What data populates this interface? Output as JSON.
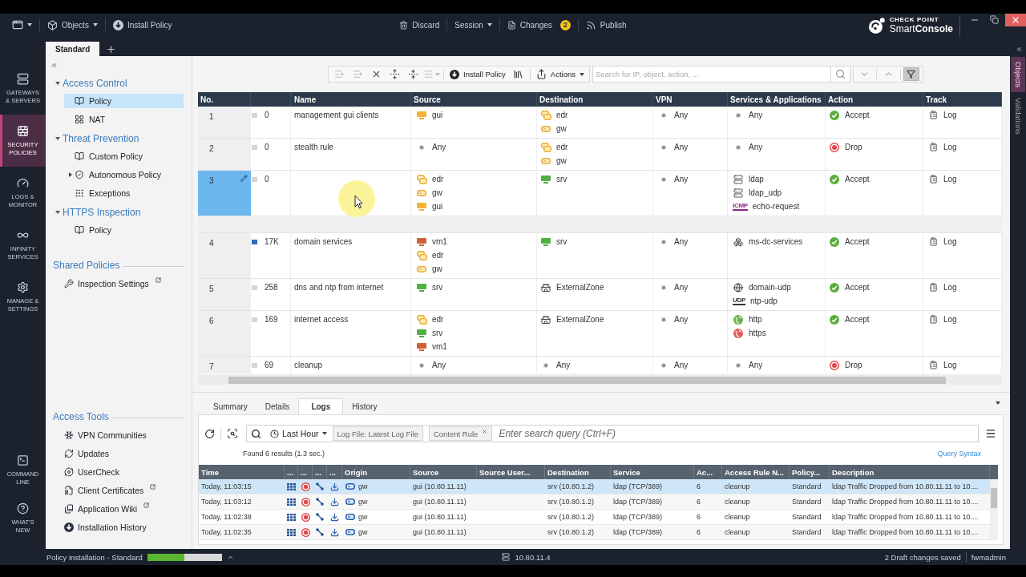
{
  "top_bar": {
    "objects": "Objects",
    "install_policy": "Install Policy",
    "discard": "Discard",
    "session": "Session",
    "changes": "Changes",
    "changes_count": "2",
    "publish": "Publish"
  },
  "brand": {
    "company": "CHECK POINT",
    "product": "Smart**Console**"
  },
  "policy_tabs": [
    {
      "label": "Standard",
      "selected": true
    }
  ],
  "side_tabs": [
    {
      "label": "Objects",
      "selected": true
    },
    {
      "label": "Validations",
      "selected": false
    }
  ],
  "nav": {
    "top": [
      {
        "kind": "gateways",
        "label": "GATEWAYS\n& SERVERS",
        "selected": false
      },
      {
        "kind": "policies",
        "label": "SECURITY\nPOLICIES",
        "selected": true
      },
      {
        "kind": "logs",
        "label": "LOGS &\nMONITOR",
        "selected": false
      },
      {
        "kind": "infinity",
        "label": "INFINITY\nSERVICES",
        "selected": false
      },
      {
        "kind": "manage",
        "label": "MANAGE &\nSETTINGS",
        "selected": false
      }
    ],
    "bottom": [
      {
        "kind": "command",
        "label": "COMMAND\nLINE",
        "selected": false
      },
      {
        "kind": "whatsnew",
        "label": "WHAT'S\nNEW",
        "selected": false
      }
    ]
  },
  "tree": [
    {
      "label": "Access Control",
      "expanded": true,
      "children": [
        {
          "label": "Policy",
          "kind": "policy",
          "selected": true
        },
        {
          "label": "NAT",
          "kind": "nat",
          "selected": false
        }
      ]
    },
    {
      "label": "Threat Prevention",
      "expanded": true,
      "children": [
        {
          "label": "Custom Policy",
          "kind": "policy",
          "selected": false
        },
        {
          "label": "Autonomous Policy",
          "kind": "autonomous",
          "selected": false,
          "expanded": false
        },
        {
          "label": "Exceptions",
          "kind": "exceptions",
          "selected": false
        }
      ]
    },
    {
      "label": "HTTPS Inspection",
      "expanded": true,
      "children": [
        {
          "label": "Policy",
          "kind": "policy",
          "selected": false
        }
      ]
    }
  ],
  "shared_policies": {
    "title": "Shared Policies",
    "items": [
      {
        "label": "Inspection Settings",
        "kind": "wrench",
        "external": true
      }
    ]
  },
  "access_tools": {
    "title": "Access Tools",
    "items": [
      {
        "label": "VPN Communities",
        "kind": "vpn",
        "external": false
      },
      {
        "label": "Updates",
        "kind": "updates",
        "external": false
      },
      {
        "label": "UserCheck",
        "kind": "usercheck",
        "external": false
      },
      {
        "label": "Client Certificates",
        "kind": "certificates",
        "external": true
      },
      {
        "label": "Application Wiki",
        "kind": "wiki",
        "external": true
      },
      {
        "label": "Installation History",
        "kind": "history",
        "external": false
      }
    ]
  },
  "rule_toolbar": {
    "tools": [
      {
        "kind": "add_above",
        "disabled": true
      },
      {
        "kind": "add_below",
        "disabled": true
      },
      {
        "kind": "delete",
        "disabled": false
      },
      {
        "kind": "expand",
        "disabled": false
      },
      {
        "kind": "collapse",
        "disabled": false
      },
      {
        "kind": "menu",
        "disabled": true
      }
    ],
    "install_policy": "Install Policy",
    "actions": "Actions",
    "search": {
      "placeholder": "Search for IP, object, action, ..."
    },
    "filter_on": true
  },
  "rule_table": {
    "columns": [
      "No.",
      "Name",
      "Source",
      "Destination",
      "VPN",
      "Services & Applications",
      "Action",
      "Track"
    ],
    "rows": [
      {
        "kind": "rule",
        "no": "1",
        "hits": "0",
        "high_hits": false,
        "selected": false,
        "edited": false,
        "name": "management gui clients",
        "source": [
          {
            "kind": "host",
            "name": "gui",
            "color": "#f2b437"
          }
        ],
        "destination": [
          {
            "kind": "cluster",
            "name": "edr"
          },
          {
            "kind": "gateway",
            "name": "gw"
          }
        ],
        "vpn": [
          {
            "kind": "any",
            "name": "Any"
          }
        ],
        "services": [
          {
            "kind": "any",
            "name": "Any"
          }
        ],
        "action": {
          "kind": "accept",
          "label": "Accept"
        },
        "track": "Log"
      },
      {
        "kind": "rule",
        "no": "2",
        "hits": "0",
        "high_hits": false,
        "selected": false,
        "edited": false,
        "name": "stealth rule",
        "source": [
          {
            "kind": "any",
            "name": "Any"
          }
        ],
        "destination": [
          {
            "kind": "cluster",
            "name": "edr"
          },
          {
            "kind": "gateway",
            "name": "gw"
          }
        ],
        "vpn": [
          {
            "kind": "any",
            "name": "Any"
          }
        ],
        "services": [
          {
            "kind": "any",
            "name": "Any"
          }
        ],
        "action": {
          "kind": "drop",
          "label": "Drop"
        },
        "track": "Log"
      },
      {
        "kind": "rule",
        "no": "3",
        "hits": "0",
        "high_hits": false,
        "selected": true,
        "edited": true,
        "source": [
          {
            "kind": "cluster",
            "name": "edr"
          },
          {
            "kind": "gateway",
            "name": "gw"
          },
          {
            "kind": "host",
            "name": "gui",
            "color": "#f2b437"
          }
        ],
        "destination": [
          {
            "kind": "host",
            "name": "srv",
            "color": "#52b043"
          }
        ],
        "vpn": [
          {
            "kind": "any",
            "name": "Any"
          }
        ],
        "services": [
          {
            "kind": "ldap",
            "name": "ldap"
          },
          {
            "kind": "ldap",
            "name": "ldap_udp"
          },
          {
            "kind": "icmp",
            "tag": "ICMP",
            "name": "echo-request"
          }
        ],
        "action": {
          "kind": "accept",
          "label": "Accept"
        },
        "track": "Log"
      },
      {
        "kind": "section"
      },
      {
        "kind": "rule",
        "no": "4",
        "hits": "17K",
        "high_hits": true,
        "selected": false,
        "edited": false,
        "name": "domain services",
        "source": [
          {
            "kind": "host",
            "name": "vm1",
            "color": "#d2603a"
          },
          {
            "kind": "cluster",
            "name": "edr"
          },
          {
            "kind": "gateway",
            "name": "gw"
          }
        ],
        "destination": [
          {
            "kind": "host",
            "name": "srv",
            "color": "#52b043"
          }
        ],
        "vpn": [
          {
            "kind": "any",
            "name": "Any"
          }
        ],
        "services": [
          {
            "kind": "group",
            "name": "ms-dc-services"
          }
        ],
        "action": {
          "kind": "accept",
          "label": "Accept"
        },
        "track": "Log"
      },
      {
        "kind": "rule",
        "no": "5",
        "hits": "258",
        "high_hits": false,
        "selected": false,
        "edited": false,
        "name": "dns and ntp from internet",
        "source": [
          {
            "kind": "host",
            "name": "srv",
            "color": "#52b043"
          }
        ],
        "destination": [
          {
            "kind": "zone",
            "name": "ExternalZone"
          }
        ],
        "vpn": [
          {
            "kind": "any",
            "name": "Any"
          }
        ],
        "services": [
          {
            "kind": "dns",
            "name": "domain-udp"
          },
          {
            "kind": "udp",
            "tag": "UDP",
            "name": "ntp-udp"
          }
        ],
        "action": {
          "kind": "accept",
          "label": "Accept"
        },
        "track": "Log"
      },
      {
        "kind": "rule",
        "no": "6",
        "hits": "169",
        "high_hits": false,
        "selected": false,
        "edited": false,
        "name": "internet access",
        "source": [
          {
            "kind": "cluster",
            "name": "edr"
          },
          {
            "kind": "host",
            "name": "srv",
            "color": "#52b043"
          },
          {
            "kind": "host",
            "name": "vm1",
            "color": "#d2603a"
          }
        ],
        "destination": [
          {
            "kind": "zone",
            "name": "ExternalZone"
          }
        ],
        "vpn": [
          {
            "kind": "any",
            "name": "Any"
          }
        ],
        "services": [
          {
            "kind": "web",
            "name": "http",
            "color": "#6db34b"
          },
          {
            "kind": "web",
            "name": "https",
            "color": "#e8585e"
          }
        ],
        "action": {
          "kind": "accept",
          "label": "Accept"
        },
        "track": "Log"
      },
      {
        "kind": "rule",
        "no": "7",
        "hits": "69",
        "high_hits": false,
        "selected": false,
        "edited": false,
        "name": "cleanup",
        "source": [
          {
            "kind": "any",
            "name": "Any"
          }
        ],
        "destination": [
          {
            "kind": "any",
            "name": "Any"
          }
        ],
        "vpn": [
          {
            "kind": "any",
            "name": "Any"
          }
        ],
        "services": [
          {
            "kind": "any",
            "name": "Any"
          }
        ],
        "action": {
          "kind": "drop",
          "label": "Drop"
        },
        "track": "Log"
      }
    ]
  },
  "details_tabs": [
    {
      "label": "Summary",
      "selected": false
    },
    {
      "label": "Details",
      "selected": false
    },
    {
      "label": "Logs",
      "selected": true
    },
    {
      "label": "History",
      "selected": false
    }
  ],
  "logs": {
    "time_range": "Last Hour",
    "chips": [
      {
        "label": "Log File: Latest Log File",
        "removable": false
      },
      {
        "label": "Content Rule",
        "removable": true
      }
    ],
    "query": {
      "placeholder": "Enter search query (Ctrl+F)"
    },
    "summary": "Found 6 results (1.3 sec.)",
    "help_link": "Query Syntax",
    "columns": [
      "Time",
      "...",
      "...",
      "...",
      "...",
      "Origin",
      "Source",
      "Source User...",
      "Destination",
      "Service",
      "Ac...",
      "Access Rule N...",
      "Policy...",
      "Description"
    ],
    "rows": [
      {
        "kind": "drop",
        "selected": true,
        "time": "Today, 11:03:15",
        "origin": "gw",
        "source": "gui (10.80.11.11)",
        "destination": "srv (10.80.1.2)",
        "service": "ldap (TCP/389)",
        "column_11": "6",
        "rule": "cleanup",
        "policy": "Standard",
        "description": "ldap Traffic Dropped from 10.80.11.11 to 10...."
      },
      {
        "kind": "drop",
        "selected": false,
        "time": "Today, 11:03:12",
        "origin": "gw",
        "source": "gui (10.80.11.11)",
        "destination": "srv (10.80.1.2)",
        "service": "ldap (TCP/389)",
        "column_11": "6",
        "rule": "cleanup",
        "policy": "Standard",
        "description": "ldap Traffic Dropped from 10.80.11.11 to 10...."
      },
      {
        "kind": "drop",
        "selected": false,
        "time": "Today, 11:02:38",
        "origin": "gw",
        "source": "gui (10.80.11.11)",
        "destination": "srv (10.80.1.2)",
        "service": "ldap (TCP/389)",
        "column_11": "6",
        "rule": "cleanup",
        "policy": "Standard",
        "description": "ldap Traffic Dropped from 10.80.11.11 to 10...."
      },
      {
        "kind": "drop",
        "selected": false,
        "time": "Today, 11:02:35",
        "origin": "gw",
        "source": "gui (10.80.11.11)",
        "destination": "srv (10.80.1.2)",
        "service": "ldap (TCP/389)",
        "column_11": "6",
        "rule": "cleanup",
        "policy": "Standard",
        "description": "ldap Traffic Dropped from 10.80.11.11 to 10...."
      }
    ]
  },
  "status_bar": {
    "task": "Policy installation - Standard",
    "level": 0.5,
    "server": "10.80.11.4",
    "drafts": "2 Draft changes saved",
    "user": "fwmadmin"
  }
}
